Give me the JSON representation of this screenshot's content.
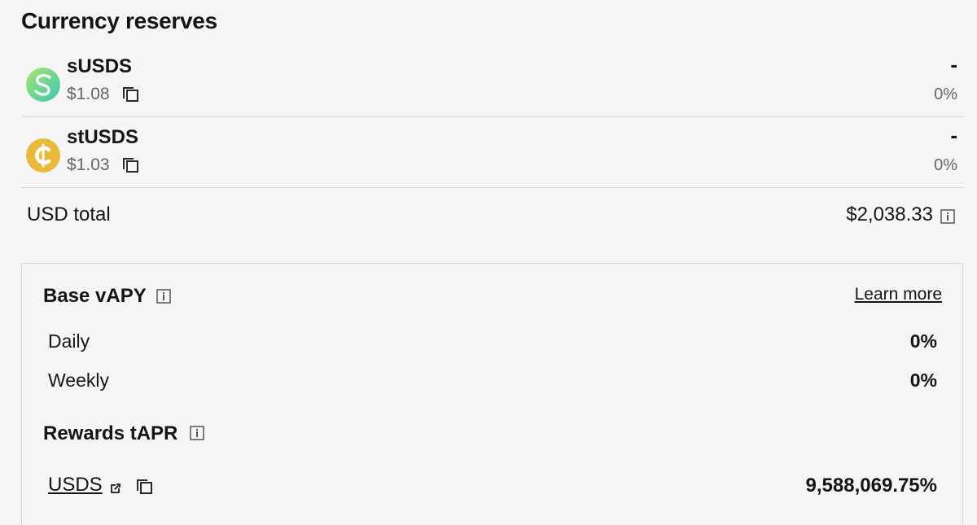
{
  "section": {
    "title": "Currency reserves"
  },
  "reserves": [
    {
      "symbol": "sUSDS",
      "price": "$1.08",
      "amount": "-",
      "percent": "0%",
      "icon": "susds-coin-icon",
      "color": "#5fd4a7"
    },
    {
      "symbol": "stUSDS",
      "price": "$1.03",
      "amount": "-",
      "percent": "0%",
      "icon": "stusds-coin-icon",
      "color": "#e8b93a"
    }
  ],
  "total": {
    "label": "USD total",
    "value": "$2,038.33",
    "icon": "info-icon"
  },
  "yield": {
    "base_title": "Base vAPY",
    "learn_more": "Learn more",
    "rates": [
      {
        "label": "Daily",
        "value": "0%"
      },
      {
        "label": "Weekly",
        "value": "0%"
      }
    ],
    "rewards_title": "Rewards tAPR",
    "rewards": [
      {
        "token": "USDS",
        "value": "9,588,069.75%",
        "icons": [
          "external-link-icon",
          "copy-icon"
        ]
      }
    ]
  }
}
